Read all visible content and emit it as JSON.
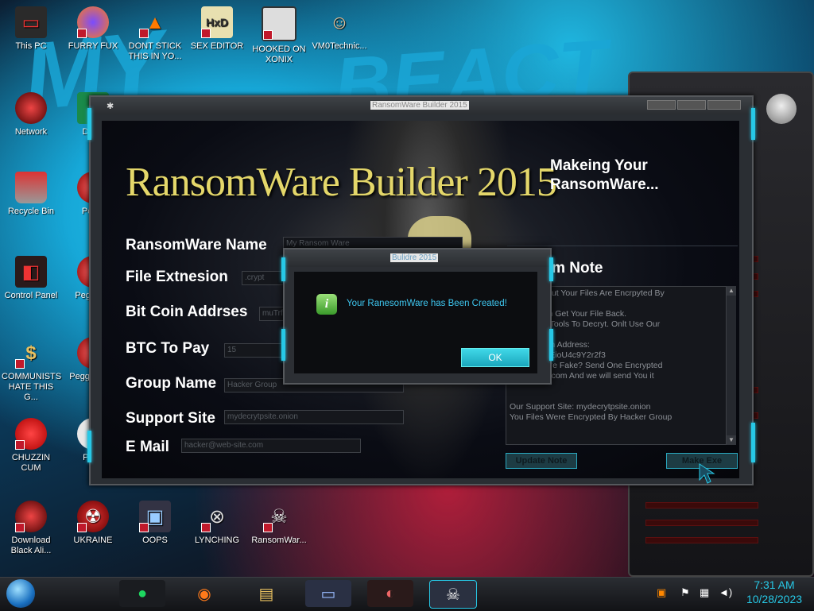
{
  "desktop": {
    "icons": [
      {
        "label": "This PC"
      },
      {
        "label": "FURRY FUX"
      },
      {
        "label": "DONT STICK THIS IN YO..."
      },
      {
        "label": "SEX EDITOR"
      },
      {
        "label": "HOOKED ON XONIX"
      },
      {
        "label": "VM0Technic..."
      },
      {
        "label": "Network"
      },
      {
        "label": "Recycle Bin"
      },
      {
        "label": "Control Panel"
      },
      {
        "label": "COMMUNISTS HATE THIS G..."
      },
      {
        "label": "CHUZZIN CUM"
      },
      {
        "label": "Download Black Ali..."
      },
      {
        "label": "UKRAINE"
      },
      {
        "label": "OOPS"
      },
      {
        "label": "LYNCHING"
      },
      {
        "label": "RansomWar..."
      }
    ],
    "partial_icons": [
      {
        "label": "D DU"
      },
      {
        "label": "Peggl"
      },
      {
        "label": "Peggl De"
      },
      {
        "label": "Peggl of Wa"
      },
      {
        "label": "Pl Zo"
      }
    ]
  },
  "window": {
    "title": "RansomWare Builder 2015",
    "banner": "RansomWare Builder 2015",
    "status_heading": "Makeing Your RansomWare...",
    "fields": [
      {
        "label": "RansomWare Name",
        "value": "My Ransom Ware"
      },
      {
        "label": "File Extnesion",
        "value": ".crypt"
      },
      {
        "label": "Bit Coin Addrses",
        "value": "muTrf2"
      },
      {
        "label": "BTC To Pay",
        "value": "15"
      },
      {
        "label": "Group Name",
        "value": "Hacker Group"
      },
      {
        "label": "Support Site",
        "value": "mydecrytpsite.onion"
      },
      {
        "label": "E Mail",
        "value": "hacker@web-site.com"
      }
    ],
    "note_title": "Ransom Note",
    "note_lines": [
      "So Sorry. But Your Files Are Encrpyted By",
      "are",
      "ry! You Can Get Your File Back.",
      "Use Other Tools To Decryt. Onlt Use Our",
      "",
      "Our Bit Coin Address:",
      "ropS9TY4fEioU4c9Y2r2f3",
      "ous We Aere Fake? Send One Encrypted",
      "@web-site.com And we will send You it",
      "",
      "",
      "Our Support Site: mydecrytpsite.onion",
      "You Files Were Encrypted By Hacker Group"
    ],
    "update_button": "Update Note",
    "make_button": "Make Exe"
  },
  "dialog": {
    "title": "Bulidre 2015",
    "message": "Your RanesomWare has Been Created!",
    "ok_label": "OK"
  },
  "taskbar": {
    "clock_time": "7:31 AM",
    "clock_date": "10/28/2023"
  },
  "colors": {
    "accent": "#27c8e6",
    "title_gold": "#e4d76a",
    "dialog_text": "#3ec6ef"
  }
}
